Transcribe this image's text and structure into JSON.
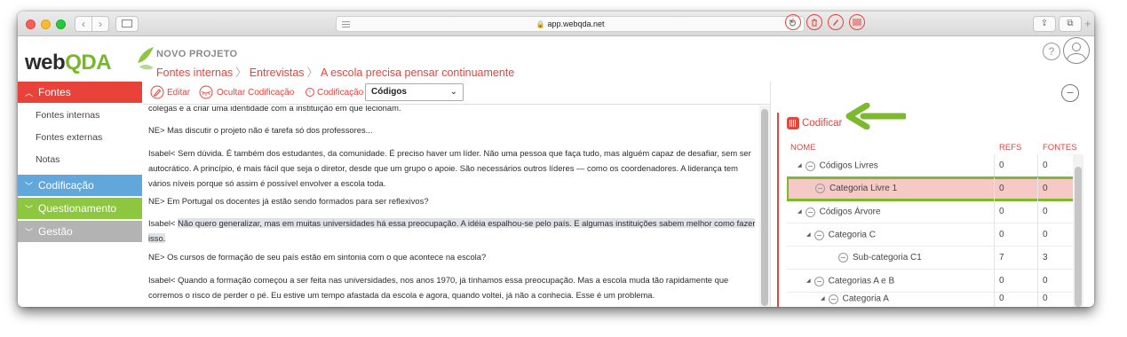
{
  "browser": {
    "url": "app.webqda.net"
  },
  "app": {
    "logo_prefix": "web",
    "logo_suffix": "QDA",
    "project_title": "NOVO PROJETO",
    "breadcrumb": [
      "Fontes internas",
      "Entrevistas",
      "A escola precisa pensar continuamente"
    ]
  },
  "sidebar": {
    "sections": [
      {
        "label": "Fontes",
        "color": "#e8423b",
        "items": [
          "Fontes internas",
          "Fontes externas",
          "Notas"
        ]
      },
      {
        "label": "Codificação",
        "color": "#62a7db"
      },
      {
        "label": "Questionamento",
        "color": "#8dc63f"
      },
      {
        "label": "Gestão",
        "color": "#b3b3b3"
      }
    ]
  },
  "toolbar": {
    "editar": "Editar",
    "ocultar": "Ocultar Codificação",
    "codificacao": "Codificação",
    "select_value": "Códigos"
  },
  "document": {
    "paragraphs": [
      "colegas e a criar uma identidade com a instituição em que lecionam.",
      "NE> Mas discutir o projeto não é tarefa só dos professores...",
      "Isabel< Sem dúvida. É também dos estudantes, da comunidade. É preciso haver um líder. Não uma pessoa que faça tudo, mas alguém capaz de desafiar, sem ser autocrático. A princípio, é mais fácil que seja o diretor, desde que um grupo o apoie. São necessários outros líderes — como os coordenadores. A liderança tem vários níveis porque só assim é possível envolver a escola toda.",
      "NE> Em Portugal os docentes já estão sendo formados para ser reflexivos?",
      "NE> Os cursos de formação de seu país estão em sintonia com o que acontece na escola?",
      "Isabel< Quando a formação começou a ser feita nas universidades, nos anos 1970, já tínhamos essa preocupação. Mas a escola muda tão rapidamente que corremos o risco de perder o pé. Eu estive um tempo afastada da escola e agora, quando voltei, já não a conhecia. Esse é um problema."
    ],
    "highlight_speaker": "Isabel<",
    "highlight_text": "Não quero generalizar, mas em muitas universidades há essa preocupação. A idéia espalhou-se pelo país. E algumas instituições sabem melhor como fazer isso.",
    "highlight_color": "#dfe3e8"
  },
  "codes_panel": {
    "action_label": "Codificar",
    "columns": [
      "NOME",
      "REFS",
      "FONTES"
    ],
    "rows": [
      {
        "name": "Códigos Livres",
        "refs": "0",
        "fontes": "0"
      },
      {
        "name": "Categoria Livre 1",
        "refs": "0",
        "fontes": "0"
      },
      {
        "name": "Códigos Árvore",
        "refs": "0",
        "fontes": "0"
      },
      {
        "name": "Categoria C",
        "refs": "0",
        "fontes": "0"
      },
      {
        "name": "Sub-categoria C1",
        "refs": "7",
        "fontes": "3"
      },
      {
        "name": "Categorias A e B",
        "refs": "0",
        "fontes": "0"
      },
      {
        "name": "Categoria A",
        "refs": "0",
        "fontes": "0"
      }
    ],
    "selected_row_color": "#f6c9c7",
    "highlight_outline_color": "#7db92f"
  },
  "colors": {
    "accent": "#e8423b",
    "brand_green": "#76b82a"
  }
}
